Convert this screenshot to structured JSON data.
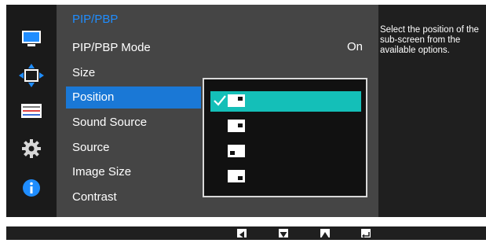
{
  "menu": {
    "title": "PIP/PBP",
    "items": [
      {
        "label": "PIP/PBP Mode",
        "value": "On"
      },
      {
        "label": "Size"
      },
      {
        "label": "Position"
      },
      {
        "label": "Sound Source"
      },
      {
        "label": "Source"
      },
      {
        "label": "Image Size"
      },
      {
        "label": "Contrast"
      }
    ],
    "selected_item": "Position"
  },
  "sidebar": {
    "icons": [
      "monitor-icon",
      "move-arrows-icon",
      "settings-panel-icon",
      "gear-icon",
      "info-icon"
    ],
    "active_icon": "move-arrows-icon"
  },
  "position_options": {
    "options": [
      "top-right",
      "bottom-left",
      "bottom-right",
      "top-left"
    ],
    "selected": "top-right"
  },
  "description": "Select the position of the sub-screen from the available options.",
  "bottom_keys": [
    "left-arrow-key-icon",
    "down-arrow-key-icon",
    "up-arrow-key-icon",
    "enter-key-icon"
  ],
  "colors": {
    "accent_blue": "#1a78d6",
    "title_blue": "#1f8dff",
    "selection_teal": "#14bfb8"
  }
}
